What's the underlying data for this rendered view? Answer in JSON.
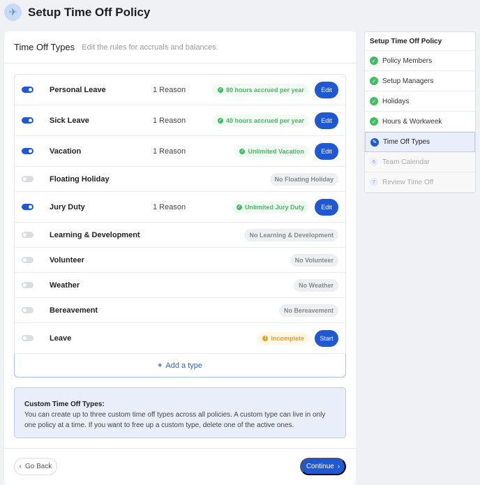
{
  "header": {
    "title": "Setup Time Off Policy",
    "icon": "airplane-icon"
  },
  "card": {
    "title": "Time Off Types",
    "subtitle": "Edit the rules for accruals and balances."
  },
  "types": [
    {
      "name": "Personal Leave",
      "enabled": true,
      "reason": "1 Reason",
      "status": "80 hours accrued per year",
      "status_kind": "ok",
      "action": "Edit"
    },
    {
      "name": "Sick Leave",
      "enabled": true,
      "reason": "1 Reason",
      "status": "40 hours accrued per year",
      "status_kind": "ok",
      "action": "Edit"
    },
    {
      "name": "Vacation",
      "enabled": true,
      "reason": "1 Reason",
      "status": "Unlimited Vacation",
      "status_kind": "ok",
      "action": "Edit"
    },
    {
      "name": "Floating Holiday",
      "enabled": false,
      "status": "No Floating Holiday",
      "status_kind": "none"
    },
    {
      "name": "Jury Duty",
      "enabled": true,
      "reason": "1 Reason",
      "status": "Unlimited Jury Duty",
      "status_kind": "ok",
      "action": "Edit"
    },
    {
      "name": "Learning & Development",
      "enabled": false,
      "status": "No Learning & Development",
      "status_kind": "none"
    },
    {
      "name": "Volunteer",
      "enabled": false,
      "status": "No Volunteer",
      "status_kind": "none"
    },
    {
      "name": "Weather",
      "enabled": false,
      "status": "No Weather",
      "status_kind": "none"
    },
    {
      "name": "Bereavement",
      "enabled": false,
      "status": "No Bereavement",
      "status_kind": "none"
    },
    {
      "name": "Leave",
      "enabled": false,
      "status": "Incomplete",
      "status_kind": "warn",
      "action": "Start"
    }
  ],
  "add_type": "Add a type",
  "info": {
    "title": "Custom Time Off Types:",
    "body": "You can create up to three custom time off types across all policies. A custom type can live in only one policy at a time. If you want to free up a custom type, delete one of the active ones."
  },
  "footer": {
    "back": "Go Back",
    "continue": "Continue"
  },
  "sidebar": {
    "title": "Setup Time Off Policy",
    "steps": [
      {
        "label": "Policy Members",
        "state": "done"
      },
      {
        "label": "Setup Managers",
        "state": "done"
      },
      {
        "label": "Holidays",
        "state": "done"
      },
      {
        "label": "Hours & Workweek",
        "state": "done"
      },
      {
        "label": "Time Off Types",
        "state": "active"
      },
      {
        "label": "Team Calendar",
        "state": "todo",
        "number": "6"
      },
      {
        "label": "Review Time Off",
        "state": "todo",
        "number": "7"
      }
    ]
  },
  "colors": {
    "primary": "#2058d1",
    "success": "#3fbf5f",
    "warning": "#f0a020"
  }
}
